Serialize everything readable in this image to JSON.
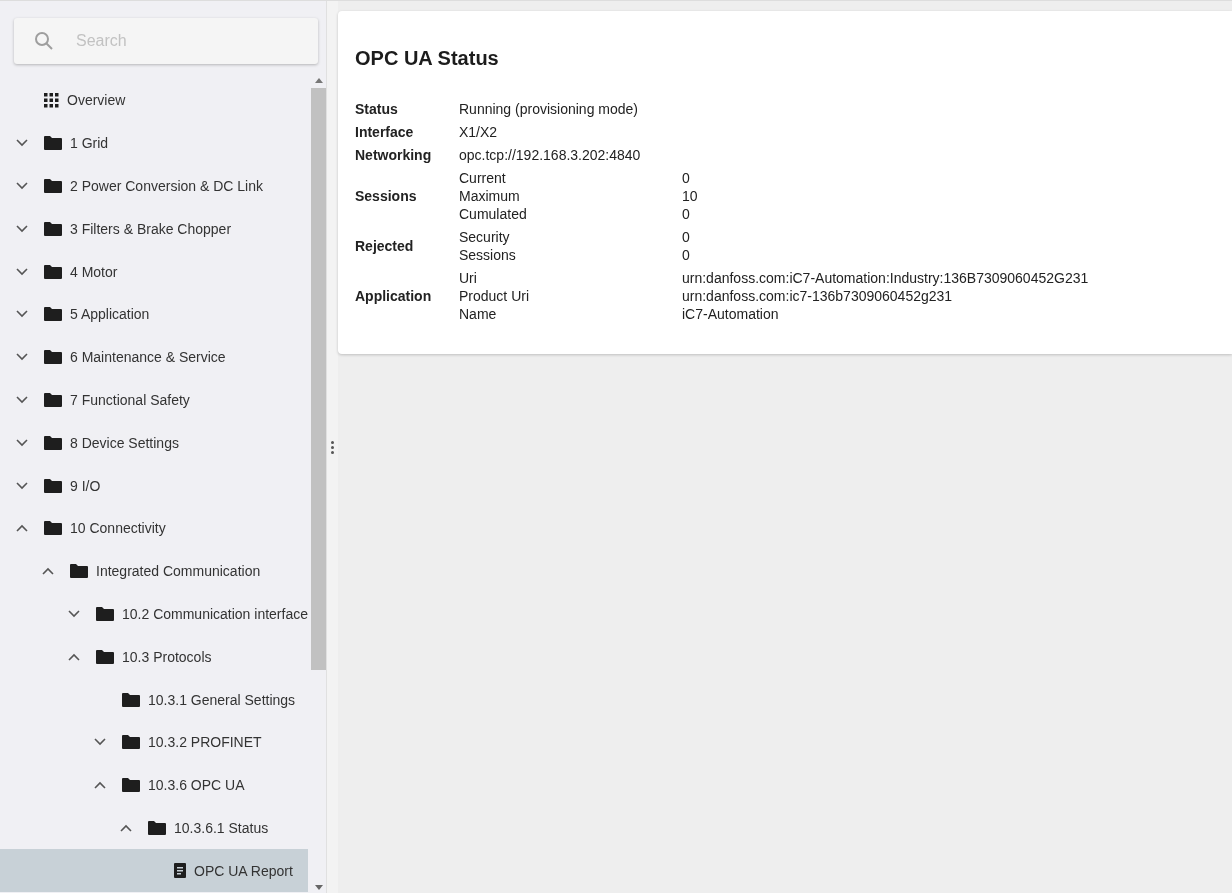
{
  "sidebar": {
    "search": {
      "placeholder": "Search"
    },
    "tree": [
      {
        "label": "Overview",
        "kind": "grid",
        "selected": false
      },
      {
        "label": "1 Grid",
        "kind": "folder",
        "expanded": false,
        "selected": false
      },
      {
        "label": "2 Power Conversion & DC Link",
        "kind": "folder",
        "expanded": false,
        "selected": false
      },
      {
        "label": "3 Filters & Brake Chopper",
        "kind": "folder",
        "expanded": false,
        "selected": false
      },
      {
        "label": "4 Motor",
        "kind": "folder",
        "expanded": false,
        "selected": false
      },
      {
        "label": "5 Application",
        "kind": "folder",
        "expanded": false,
        "selected": false
      },
      {
        "label": "6 Maintenance & Service",
        "kind": "folder",
        "expanded": false,
        "selected": false
      },
      {
        "label": "7 Functional Safety",
        "kind": "folder",
        "expanded": false,
        "selected": false
      },
      {
        "label": "8 Device Settings",
        "kind": "folder",
        "expanded": false,
        "selected": false
      },
      {
        "label": "9 I/O",
        "kind": "folder",
        "expanded": false,
        "selected": false
      },
      {
        "label": "10 Connectivity",
        "kind": "folder",
        "expanded": true,
        "selected": false,
        "children": [
          {
            "label": "Integrated Communication",
            "kind": "folder",
            "expanded": true,
            "selected": false,
            "children": [
              {
                "label": "10.2 Communication interface",
                "kind": "folder",
                "expanded": false,
                "selected": false
              },
              {
                "label": "10.3 Protocols",
                "kind": "folder",
                "expanded": true,
                "selected": false,
                "children": [
                  {
                    "label": "10.3.1 General Settings",
                    "kind": "folder",
                    "selected": false
                  },
                  {
                    "label": "10.3.2 PROFINET",
                    "kind": "folder",
                    "expanded": false,
                    "selected": false
                  },
                  {
                    "label": "10.3.6 OPC UA",
                    "kind": "folder",
                    "expanded": true,
                    "selected": false,
                    "children": [
                      {
                        "label": "10.3.6.1 Status",
                        "kind": "folder",
                        "expanded": true,
                        "selected": false,
                        "children": [
                          {
                            "label": "OPC UA Report",
                            "kind": "document",
                            "selected": true
                          }
                        ]
                      }
                    ]
                  }
                ]
              }
            ]
          }
        ]
      }
    ]
  },
  "card": {
    "title": "OPC UA Status",
    "rows": [
      {
        "kind": "single",
        "label": "Status",
        "value": "Running (provisioning mode)"
      },
      {
        "kind": "single",
        "label": "Interface",
        "value": "X1/X2"
      },
      {
        "kind": "single",
        "label": "Networking",
        "value": "opc.tcp://192.168.3.202:4840"
      },
      {
        "kind": "group",
        "label": "Sessions",
        "items": [
          {
            "name": "Current",
            "value": "0"
          },
          {
            "name": "Maximum",
            "value": "10"
          },
          {
            "name": "Cumulated",
            "value": "0"
          }
        ]
      },
      {
        "kind": "group",
        "label": "Rejected",
        "items": [
          {
            "name": "Security",
            "value": "0"
          },
          {
            "name": "Sessions",
            "value": "0"
          }
        ]
      },
      {
        "kind": "group",
        "label": "Application",
        "items": [
          {
            "name": "Uri",
            "value": "urn:danfoss.com:iC7-Automation:Industry:136B7309060452G231"
          },
          {
            "name": "Product Uri",
            "value": "urn:danfoss.com:ic7-136b7309060452g231"
          },
          {
            "name": "Name",
            "value": "iC7-Automation"
          }
        ]
      }
    ]
  }
}
